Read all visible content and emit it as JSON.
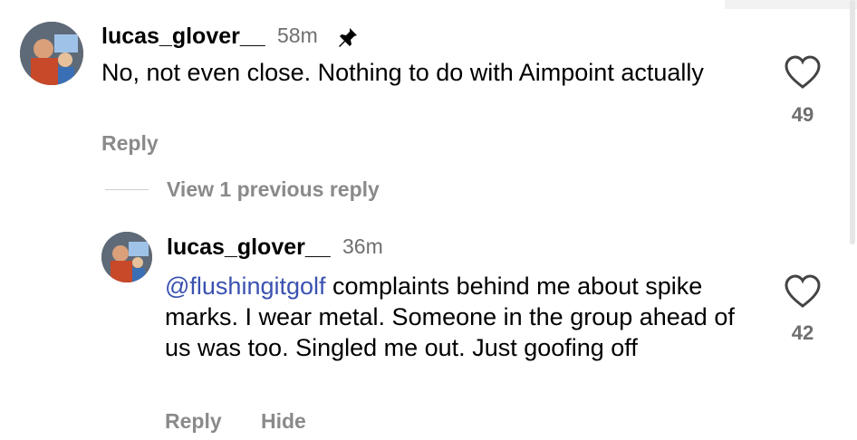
{
  "comments": [
    {
      "username": "lucas_glover__",
      "time": "58m",
      "pinned": true,
      "text": "No, not even close.  Nothing to do with Aimpoint actually",
      "likes": "49",
      "reply_label": "Reply"
    }
  ],
  "view_previous": "View 1 previous reply",
  "reply": {
    "username": "lucas_glover__",
    "time": "36m",
    "mention": "@flushingitgolf",
    "text": " complaints behind me about spike marks.  I wear metal.  Someone in the group ahead of us was too.  Singled me out.  Just goofing off",
    "likes": "42",
    "reply_label": "Reply",
    "hide_label": "Hide"
  },
  "icons": {
    "pin": "pin-icon",
    "heart": "heart-outline-icon"
  },
  "colors": {
    "mention": "#3a52b0",
    "secondary": "#6f6f6f"
  }
}
